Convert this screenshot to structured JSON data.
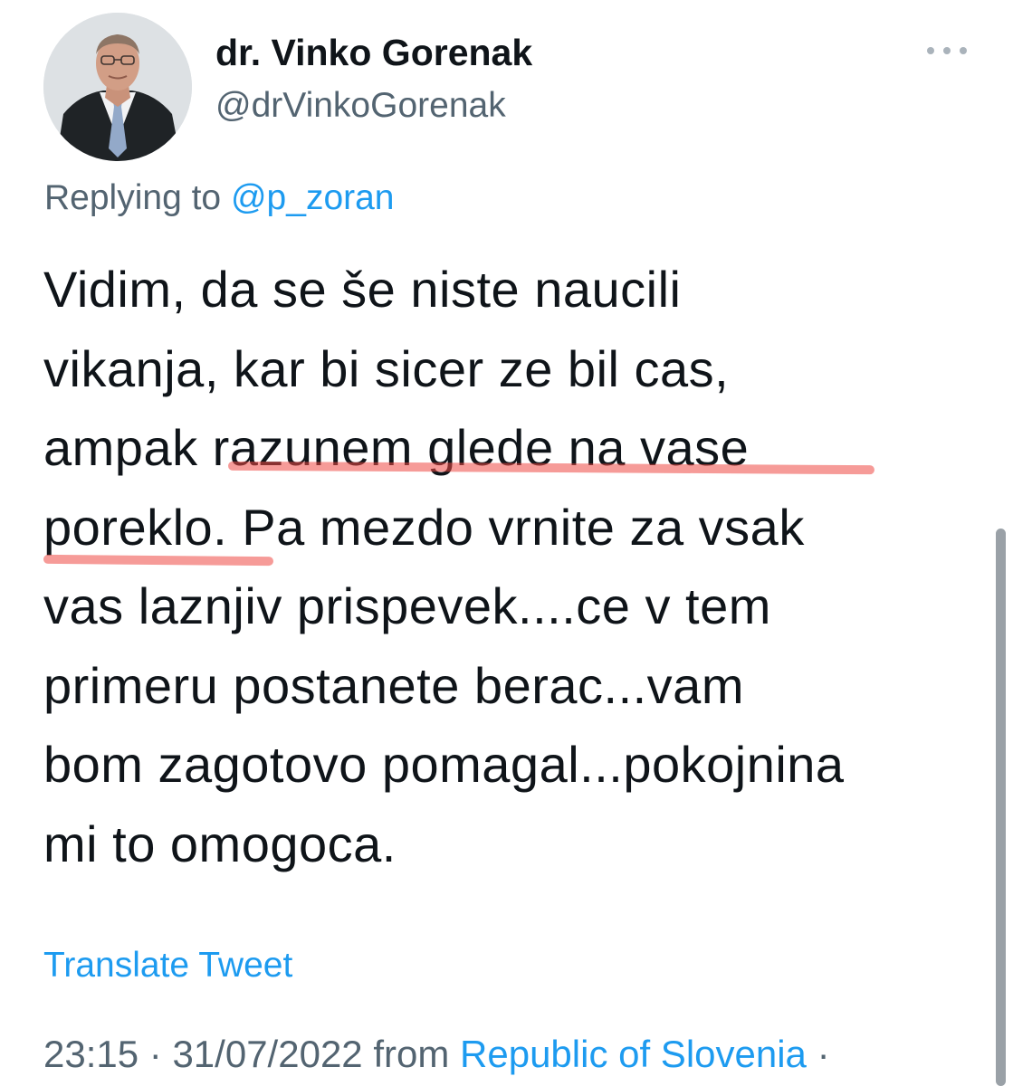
{
  "author": {
    "display_name": "dr. Vinko Gorenak",
    "handle": "@drVinkoGorenak",
    "avatar_icon": "profile-photo-avatar"
  },
  "more_icon": "more-horizontal-icon",
  "reply": {
    "prefix": "Replying to",
    "mention": "@p_zoran"
  },
  "tweet": {
    "lines": [
      "Vidim, da se še niste naucili",
      "vikanja, kar bi sicer ze bil cas,",
      "ampak razunem glede na vase",
      "poreklo. Pa mezdo vrnite za vsak",
      "vas laznjiv prispevek....ce v tem",
      "primeru postanete berac...vam",
      "bom zagotovo pomagal...pokojnina",
      "mi to omogoca."
    ],
    "highlight_color": "#ee4844"
  },
  "translate_label": "Translate Tweet",
  "meta": {
    "time": "23:15",
    "separator": "·",
    "date": "31/07/2022",
    "from_label": "from",
    "source": "Republic of Slovenia",
    "trailing_dot": "·"
  },
  "colors": {
    "text": "#0f1419",
    "secondary": "#536471",
    "link": "#1d9bf0"
  }
}
